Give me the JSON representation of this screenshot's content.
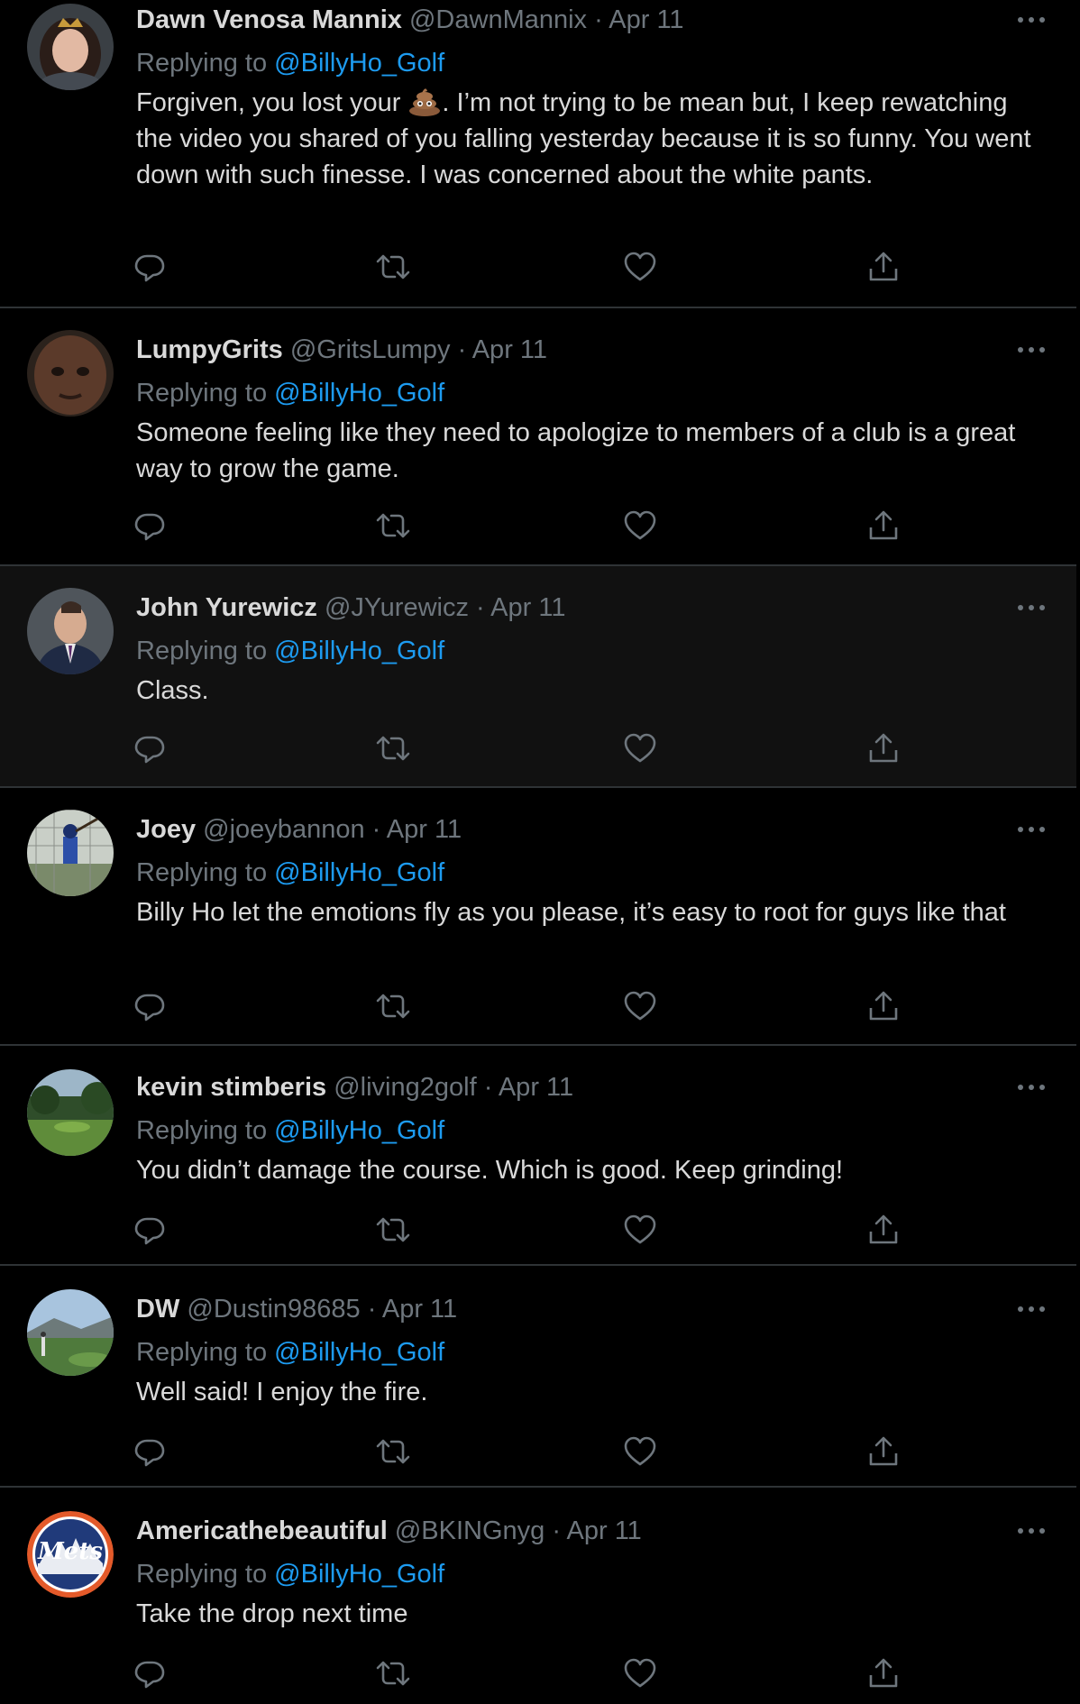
{
  "tweets": [
    {
      "name": "Dawn Venosa Mannix",
      "handle": "@DawnMannix",
      "sep": "·",
      "date": "Apr 11",
      "replying_label": "Replying to",
      "mention": "@BillyHo_Golf",
      "text_before": "Forgiven, you lost your ",
      "emoji": "poop-emoji",
      "text_after": ". I’m not trying to be mean but, I keep rewatching the video you shared of you falling yesterday because it is so funny. You went down with such finesse. I was concerned about the white pants.",
      "avatar": "woman-with-tiara"
    },
    {
      "name": "LumpyGrits",
      "handle": "@GritsLumpy",
      "sep": "·",
      "date": "Apr 11",
      "replying_label": "Replying to",
      "mention": "@BillyHo_Golf",
      "text": "Someone feeling like they need to apologize to members of a club is a great way to grow the game.",
      "avatar": "man-face-closeup"
    },
    {
      "name": "John Yurewicz",
      "handle": "@JYurewicz",
      "sep": "·",
      "date": "Apr 11",
      "replying_label": "Replying to",
      "mention": "@BillyHo_Golf",
      "text": "Class.",
      "avatar": "man-in-suit",
      "highlighted": true
    },
    {
      "name": "Joey",
      "handle": "@joeybannon",
      "sep": "·",
      "date": "Apr 11",
      "replying_label": "Replying to",
      "mention": "@BillyHo_Golf",
      "text": "Billy Ho let the emotions fly as you please, it’s easy to root for guys like that",
      "avatar": "baseball-batter"
    },
    {
      "name": "kevin stimberis",
      "handle": "@living2golf",
      "sep": "·",
      "date": "Apr 11",
      "replying_label": "Replying to",
      "mention": "@BillyHo_Golf",
      "text": "You didn’t damage the course. Which is good. Keep grinding!",
      "avatar": "golf-course"
    },
    {
      "name": "DW",
      "handle": "@Dustin98685",
      "sep": "·",
      "date": "Apr 11",
      "replying_label": "Replying to",
      "mention": "@BillyHo_Golf",
      "text": "Well said! I enjoy the fire.",
      "avatar": "golfer-on-course"
    },
    {
      "name": "Americathebeautiful",
      "handle": "@BKINGnyg",
      "sep": "·",
      "date": "Apr 11",
      "replying_label": "Replying to",
      "mention": "@BillyHo_Golf",
      "text": "Take the drop next time",
      "avatar": "mets-logo",
      "avatar_logo_text": "Mets"
    }
  ],
  "icons": {
    "more": "more-options-icon",
    "reply": "reply-icon",
    "retweet": "retweet-icon",
    "like": "like-icon",
    "share": "share-icon"
  },
  "colors": {
    "background": "#000000",
    "highlight": "#111111",
    "text": "#d9d9d9",
    "secondary": "#6e767d",
    "mention": "#1d9bf0",
    "divider": "#2f3336"
  }
}
